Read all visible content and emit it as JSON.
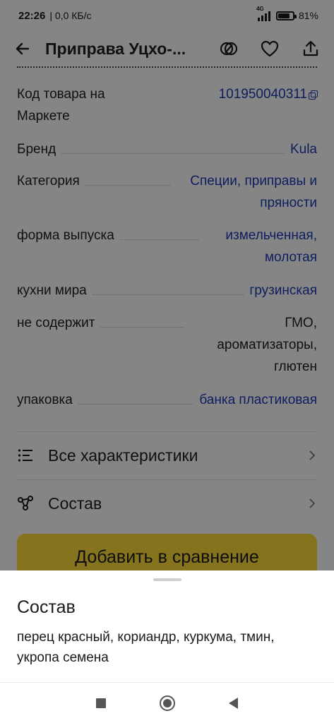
{
  "status_bar": {
    "time": "22:26",
    "network_speed": "0,0 КБ/с",
    "network_type": "4G",
    "battery": "81%"
  },
  "app_bar": {
    "title": "Приправа Уцхо-...",
    "back_icon": "arrow-left-icon",
    "compare_icon": "compare-icon",
    "favorite_icon": "heart-icon",
    "share_icon": "share-icon"
  },
  "specs": [
    {
      "label": "Код товара на Маркете",
      "value": "101950040311",
      "link": true,
      "copy": true
    },
    {
      "label": "Бренд",
      "value": "Kula",
      "link": true
    },
    {
      "label": "Категория",
      "value": "Специи, приправы и пряности",
      "link": true
    },
    {
      "label": "форма выпуска",
      "value": "измельченная, молотая",
      "link": true
    },
    {
      "label": "кухни мира",
      "value": "грузинская",
      "link": true
    },
    {
      "label": "не содержит",
      "value": "ГМО, ароматизаторы, глютен",
      "link": false
    },
    {
      "label": "упаковка",
      "value": "банка пластиковая",
      "link": true
    }
  ],
  "menu": {
    "all_specs": "Все характеристики",
    "composition": "Состав"
  },
  "compare_button": "Добавить в сравнение",
  "sheet": {
    "title": "Состав",
    "text": "перец красный, кориандр, куркума, тмин, укропа семена"
  },
  "colors": {
    "link": "#1b3bb5",
    "accent_button": "#ffdc38"
  }
}
